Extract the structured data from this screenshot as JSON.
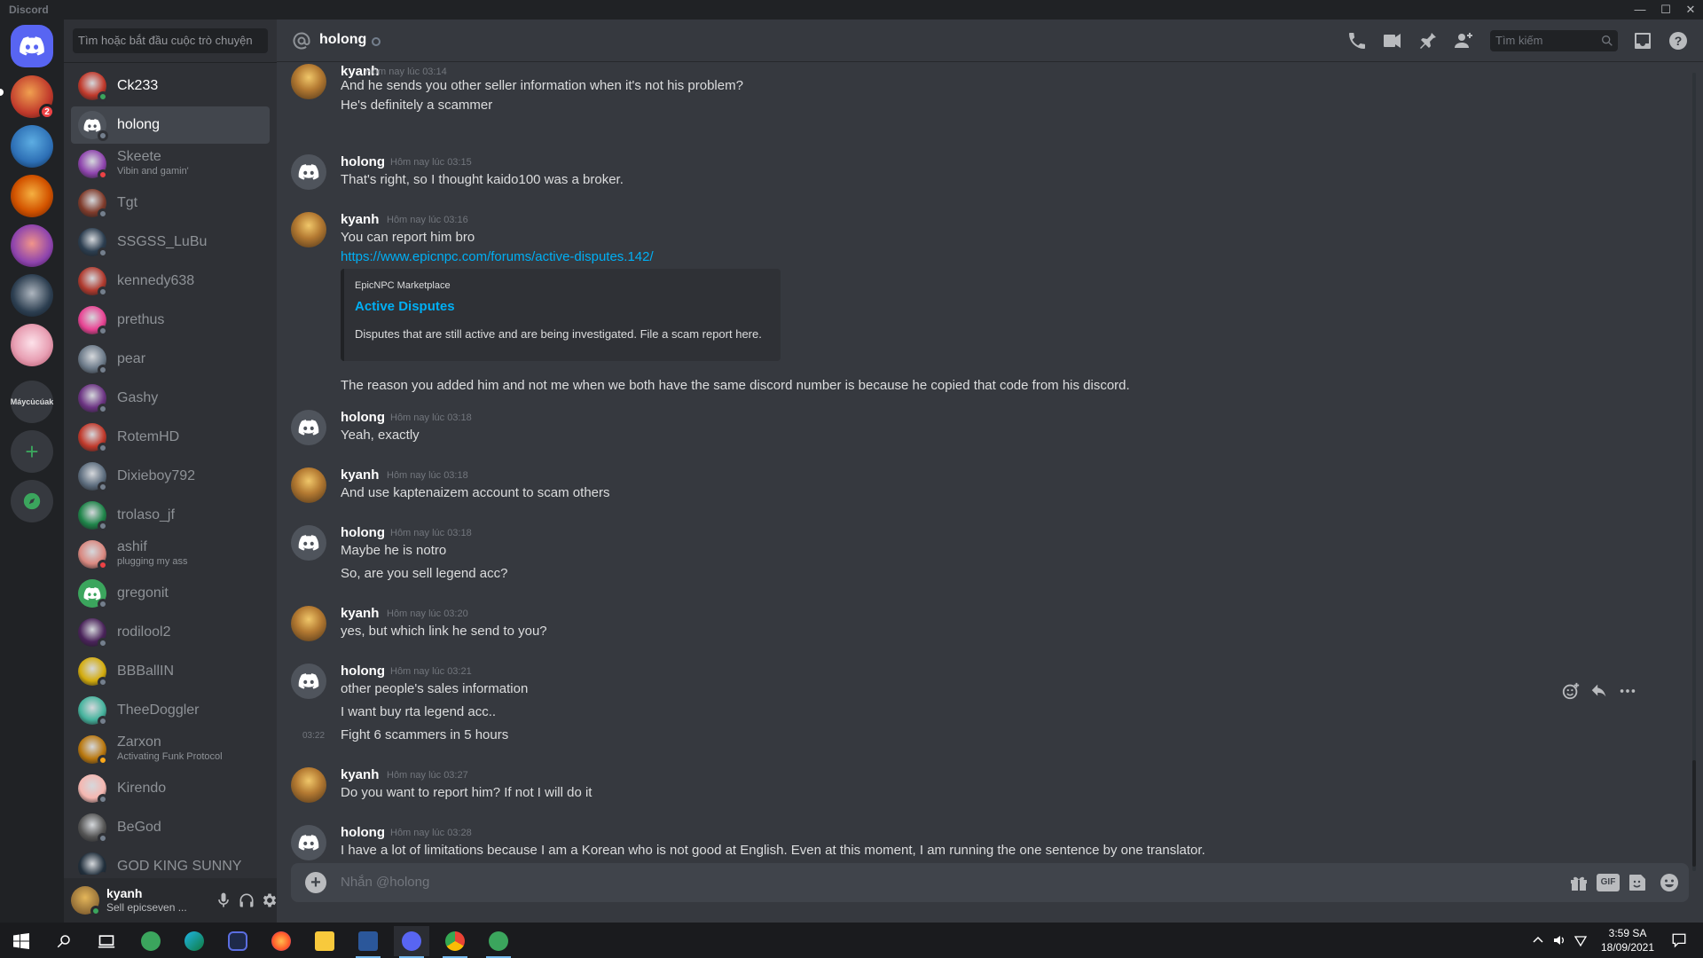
{
  "window": {
    "title": "Discord"
  },
  "servers": {
    "unread_badge": "2",
    "text_server": "Máycủcúak",
    "avatars": [
      "#c0392b",
      "#2d6fb5",
      "#d35400",
      "#8e44ad",
      "#2c3e50",
      "#e8a0b4"
    ]
  },
  "sidebar": {
    "search_placeholder": "Tìm hoặc bắt đầu cuộc trò chuyện",
    "dms": [
      {
        "name": "Ck233",
        "status": "online",
        "color": "#c0392b"
      },
      {
        "name": "holong",
        "status": "offline",
        "color": "#4f545c"
      },
      {
        "name": "Skeete",
        "sub": "Vibin and gamin'",
        "status": "dnd",
        "color": "#8e44ad"
      },
      {
        "name": "Tgt",
        "status": "offline",
        "color": "#7f3b2b"
      },
      {
        "name": "SSGSS_LuBu",
        "status": "offline",
        "color": "#2c3e50"
      },
      {
        "name": "kennedy638",
        "status": "offline",
        "color": "#b03a2e"
      },
      {
        "name": "prethus",
        "status": "offline",
        "color": "#e84393"
      },
      {
        "name": "pear",
        "status": "offline",
        "color": "#6c7a89"
      },
      {
        "name": "Gashy",
        "status": "offline",
        "color": "#6c3483"
      },
      {
        "name": "RotemHD",
        "status": "offline",
        "color": "#c0392b"
      },
      {
        "name": "Dixieboy792",
        "status": "offline",
        "color": "#5d6d7e"
      },
      {
        "name": "trolaso_jf",
        "status": "offline",
        "color": "#1e8449"
      },
      {
        "name": "ashif",
        "sub": "plugging my ass",
        "status": "dnd",
        "color": "#d98880"
      },
      {
        "name": "gregonit",
        "status": "offline",
        "color": "#3ba55d"
      },
      {
        "name": "rodilool2",
        "status": "offline",
        "color": "#4a235a"
      },
      {
        "name": "BBBallIN",
        "status": "offline",
        "color": "#d4ac0d"
      },
      {
        "name": "TheeDoggler",
        "status": "offline",
        "color": "#45b39d"
      },
      {
        "name": "Zarxon",
        "sub": "Activating Funk Protocol",
        "status": "idle",
        "color": "#b9770e"
      },
      {
        "name": "Kirendo",
        "status": "offline",
        "color": "#f5b7b1"
      },
      {
        "name": "BeGod",
        "status": "offline",
        "color": "#555"
      },
      {
        "name": "GOD KING SUNNY",
        "status": "offline",
        "color": "#212f3c"
      }
    ]
  },
  "user_panel": {
    "name": "kyanh",
    "status": "Sell epicseven ..."
  },
  "header": {
    "title": "holong",
    "search_placeholder": "Tìm kiếm"
  },
  "messages": {
    "m1": {
      "author": "kyanh",
      "time": "Hôm nay lúc 03:14",
      "lines": [
        "And he sends you other seller information when it's not his problem?",
        "He's definitely a scammer"
      ]
    },
    "m2": {
      "author": "holong",
      "time": "Hôm nay lúc 03:15",
      "lines": [
        "That's right, so I thought kaido100 was a broker."
      ]
    },
    "m3": {
      "author": "kyanh",
      "time": "Hôm nay lúc 03:16",
      "lines": [
        "You can report him bro",
        "https://www.epicnpc.com/forums/active-disputes.142/",
        "The reason you added him and not me when we both have the same discord number is because he copied that code from his discord."
      ],
      "embed": {
        "provider": "EpicNPC Marketplace",
        "title": "Active Disputes",
        "description": "Disputes that are still active and are being investigated. File a scam report here."
      }
    },
    "m4": {
      "author": "holong",
      "time": "Hôm nay lúc 03:18",
      "lines": [
        "Yeah,  exactly"
      ]
    },
    "m5": {
      "author": "kyanh",
      "time": "Hôm nay lúc 03:18",
      "lines": [
        "And use kaptenaizem account to scam others"
      ]
    },
    "m6": {
      "author": "holong",
      "time": "Hôm nay lúc 03:18",
      "lines": [
        "Maybe he is notro",
        "So, are you sell legend acc?"
      ]
    },
    "m7": {
      "author": "kyanh",
      "time": "Hôm nay lúc 03:20",
      "lines": [
        "yes, but which link he send to you?"
      ]
    },
    "m8": {
      "author": "holong",
      "time": "Hôm nay lúc 03:21",
      "lines": [
        "other people's sales information",
        "I want buy rta legend acc..",
        "Fight 6 scammers in 5 hours"
      ],
      "side_time": "03:22"
    },
    "m9": {
      "author": "kyanh",
      "time": "Hôm nay lúc 03:27",
      "lines": [
        "Do you want to report him? If not I will do it"
      ]
    },
    "m10": {
      "author": "holong",
      "time": "Hôm nay lúc 03:28",
      "lines": [
        "I have a lot of limitations because I am a Korean who is not good at English. Even at this moment, I am running the one sentence by one translator."
      ]
    }
  },
  "composer": {
    "placeholder": "Nhắn @holong",
    "gif_label": "GIF"
  },
  "taskbar": {
    "time": "3:59 SA",
    "date": "18/09/2021"
  },
  "colors": {
    "accent": "#5865f2",
    "link": "#00aff4",
    "online": "#3ba55d",
    "dnd": "#ed4245",
    "idle": "#faa81a"
  }
}
